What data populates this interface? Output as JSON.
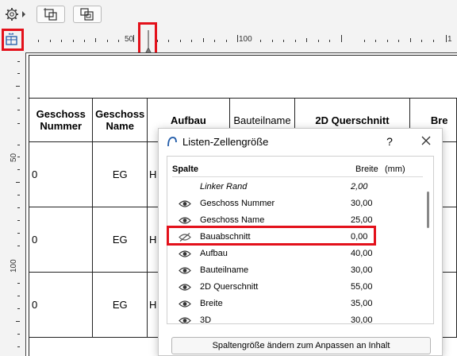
{
  "toolbar": {
    "icons": [
      "settings-gear-icon",
      "dropdown-arrow-icon",
      "fit-table-icon",
      "fit-cells-icon"
    ]
  },
  "ruler": {
    "horizontal_labels": [
      "50",
      "100",
      "1"
    ],
    "vertical_labels": [
      "50",
      "100"
    ]
  },
  "table": {
    "headers": [
      "Geschoss Nummer",
      "Geschoss Name",
      "Aufbau",
      "Bauteilname",
      "2D Querschnitt",
      "Bre"
    ],
    "rows": [
      {
        "nummer": "0",
        "name": "EG",
        "aufbau": "H"
      },
      {
        "nummer": "0",
        "name": "EG",
        "aufbau": "H"
      },
      {
        "nummer": "0",
        "name": "EG",
        "aufbau": "H"
      }
    ]
  },
  "dialog": {
    "title": "Listen-Zellengröße",
    "help": "?",
    "col_spalte": "Spalte",
    "col_breite": "Breite",
    "col_unit": "(mm)",
    "rows": [
      {
        "name": "Linker Rand",
        "value": "2,00",
        "icon": "none",
        "italic": true
      },
      {
        "name": "Geschoss Nummer",
        "value": "30,00",
        "icon": "eye-icon",
        "italic": false
      },
      {
        "name": "Geschoss Name",
        "value": "25,00",
        "icon": "eye-icon",
        "italic": false
      },
      {
        "name": "Bauabschnitt",
        "value": "0,00",
        "icon": "eye-hidden-icon",
        "italic": false
      },
      {
        "name": "Aufbau",
        "value": "40,00",
        "icon": "eye-icon",
        "italic": false
      },
      {
        "name": "Bauteilname",
        "value": "30,00",
        "icon": "eye-icon",
        "italic": false
      },
      {
        "name": "2D Querschnitt",
        "value": "55,00",
        "icon": "eye-icon",
        "italic": false
      },
      {
        "name": "Breite",
        "value": "35,00",
        "icon": "eye-icon",
        "italic": false
      },
      {
        "name": "3D",
        "value": "30,00",
        "icon": "eye-icon",
        "italic": false
      }
    ],
    "fit_button": "Spaltengröße ändern zum Anpassen an Inhalt"
  },
  "colors": {
    "highlight": "#e3111b",
    "sheet": "#ffffff",
    "background": "#f3f3f3"
  }
}
